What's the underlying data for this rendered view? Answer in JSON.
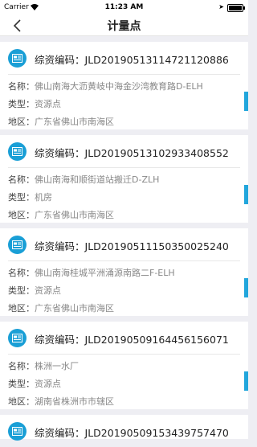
{
  "status": {
    "carrier": "Carrier",
    "time": "11:23 AM"
  },
  "nav": {
    "title": "计量点"
  },
  "labels": {
    "code": "综资编码：",
    "name": "名称：",
    "type": "类型：",
    "region": "地区："
  },
  "items": [
    {
      "code": "JLD20190513114721120886",
      "name": "佛山南海大沥黄岐中海金沙湾教育路D-ELH",
      "type": "资源点",
      "region": "广东省佛山市南海区"
    },
    {
      "code": "JLD20190513102933408552",
      "name": "佛山南海和顺街道站搬迁D-ZLH",
      "type": "机房",
      "region": "广东省佛山市南海区"
    },
    {
      "code": "JLD20190511150350025240",
      "name": "佛山南海桂城平洲涌源南路二F-ELH",
      "type": "资源点",
      "region": "广东省佛山市南海区"
    },
    {
      "code": "JLD20190509164456156071",
      "name": "株洲一水厂",
      "type": "资源点",
      "region": "湖南省株洲市市辖区"
    },
    {
      "code": "JLD20190509153439757470"
    }
  ]
}
